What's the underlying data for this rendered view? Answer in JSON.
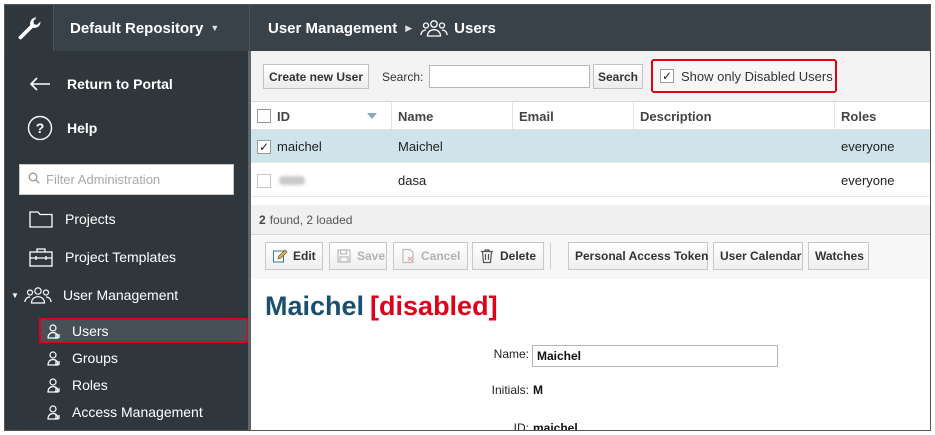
{
  "header": {
    "repository": "Default Repository",
    "breadcrumb_section": "User Management",
    "breadcrumb_page": "Users"
  },
  "sidebar": {
    "return_label": "Return to Portal",
    "help_label": "Help",
    "filter_placeholder": "Filter Administration",
    "items": [
      {
        "label": "Projects",
        "icon": "folder-icon"
      },
      {
        "label": "Project Templates",
        "icon": "toolbox-icon"
      },
      {
        "label": "User Management",
        "icon": "users-icon"
      }
    ],
    "subitems": [
      {
        "label": "Users",
        "icon": "user-icon",
        "active": true
      },
      {
        "label": "Groups",
        "icon": "user-icon"
      },
      {
        "label": "Roles",
        "icon": "user-icon"
      },
      {
        "label": "Access Management",
        "icon": "user-icon"
      }
    ]
  },
  "toolbar": {
    "create_label": "Create new User",
    "search_label": "Search:",
    "search_value": "",
    "search_button": "Search",
    "disabled_filter_label": "Show only Disabled Users",
    "disabled_filter_checked": true
  },
  "table": {
    "columns": [
      "ID",
      "Name",
      "Email",
      "Description",
      "Roles"
    ],
    "rows": [
      {
        "id": "maichel",
        "name": "Maichel",
        "email": "",
        "description": "",
        "roles": "everyone",
        "checked": true,
        "selected": true
      },
      {
        "id": "",
        "name": "dasa",
        "email": "",
        "description": "",
        "roles": "everyone",
        "checked": false,
        "selected": false,
        "id_obscured": true
      }
    ],
    "found_count": "2",
    "found_text": "found, 2 loaded"
  },
  "actions": {
    "edit": "Edit",
    "save": "Save",
    "cancel": "Cancel",
    "delete": "Delete",
    "pat": "Personal Access Token",
    "calendar": "User Calendar",
    "watches": "Watches"
  },
  "detail": {
    "title": "Maichel",
    "status_flag": "[disabled]",
    "name_label": "Name:",
    "name_value": "Maichel",
    "initials_label": "Initials:",
    "initials_value": "M",
    "id_label": "ID:",
    "id_value": "maichel"
  },
  "colors": {
    "sidebar_bg": "#2f373d",
    "topbar_bg": "#3a4249",
    "selected_row": "#cfe4ea",
    "title_blue": "#1b4f6f",
    "highlight_red": "#e0001a"
  }
}
